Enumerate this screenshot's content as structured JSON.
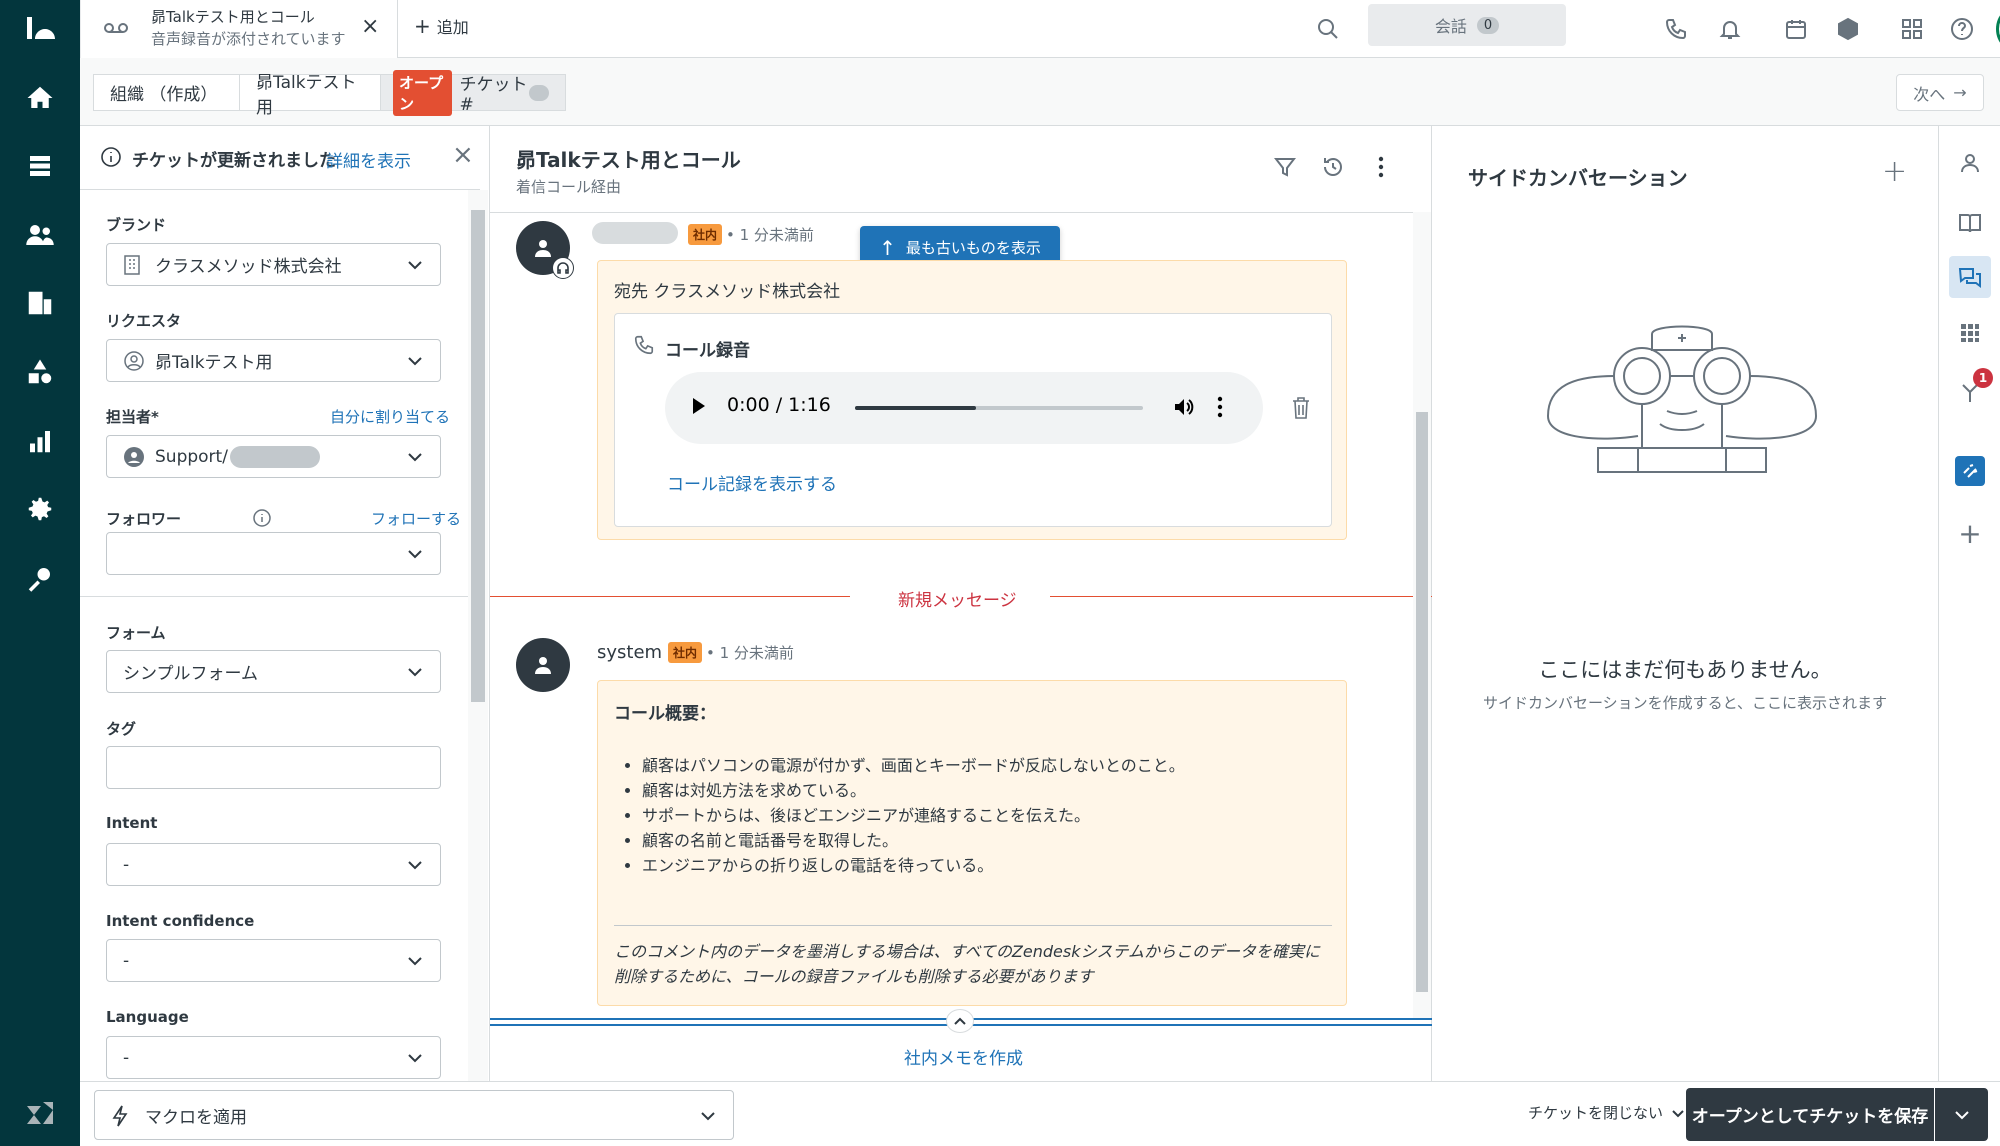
{
  "top": {
    "tab_title": "昴Talkテスト用とコール",
    "tab_subtitle": "音声録音が添付されています",
    "add_label": "追加",
    "conversations_label": "会話",
    "conversations_count": "0"
  },
  "subbar": {
    "crumb_org": "組織 （作成）",
    "crumb_user": "昴Talkテスト用",
    "status_badge": "オープン",
    "crumb_ticket": "チケット #",
    "next_label": "次へ"
  },
  "notice": {
    "text": "チケットが更新されました",
    "link": "詳細を表示"
  },
  "fields": {
    "brand_label": "ブランド",
    "brand_value": "クラスメソッド株式会社",
    "requester_label": "リクエスタ",
    "requester_value": "昴Talkテスト用",
    "assignee_label": "担当者*",
    "assignee_link": "自分に割り当てる",
    "assignee_value": "Support/",
    "follower_label": "フォロワー",
    "follower_link": "フォローする",
    "form_label": "フォーム",
    "form_value": "シンプルフォーム",
    "tags_label": "タグ",
    "intent_label": "Intent",
    "intent_value": "-",
    "intent_conf_label": "Intent confidence",
    "intent_conf_value": "-",
    "language_label": "Language",
    "language_value": "-"
  },
  "center": {
    "title": "昴Talkテスト用とコール",
    "subtitle": "着信コール経由",
    "show_oldest": "最も古いものを表示",
    "msg1": {
      "badge": "社内",
      "time": "1 分未満前",
      "to_label": "宛先 クラスメソッド株式会社",
      "recording_label": "コール録音",
      "player_time": "0:00 / 1:16",
      "player_progress": 0.42,
      "show_transcript": "コール記録を表示する"
    },
    "new_messages": "新規メッセージ",
    "msg2": {
      "author": "system",
      "badge": "社内",
      "time": "1 分未満前",
      "summary_title": "コール概要：",
      "bullets": [
        "顧客はパソコンの電源が付かず、画面とキーボードが反応しないとのこと。",
        "顧客は対処方法を求めている。",
        "サポートからは、後ほどエンジニアが連絡することを伝えた。",
        "顧客の名前と電話番号を取得した。",
        "エンジニアからの折り返しの電話を待っている。"
      ],
      "note": "このコメント内のデータを墨消しする場合は、すべてのZendeskシステムからこのデータを確実に削除するために、コールの録音ファイルも削除する必要があります"
    },
    "compose_label": "社内メモを作成"
  },
  "side": {
    "title": "サイドカンバセーション",
    "empty_title": "ここにはまだ何もありません。",
    "empty_desc": "サイドカンバセーションを作成すると、ここに表示されます"
  },
  "rail": {
    "notif_count": "1"
  },
  "bottom": {
    "macro_label": "マクロを適用",
    "close_label": "チケットを閉じない",
    "save_label": "オープンとしてチケットを保存"
  },
  "colors": {
    "nav_bg": "#03363d",
    "accent": "#1f73b7",
    "status_open": "#e34f32",
    "internal_bg": "#fff6e8",
    "internal_badge": "#f79a3e"
  }
}
